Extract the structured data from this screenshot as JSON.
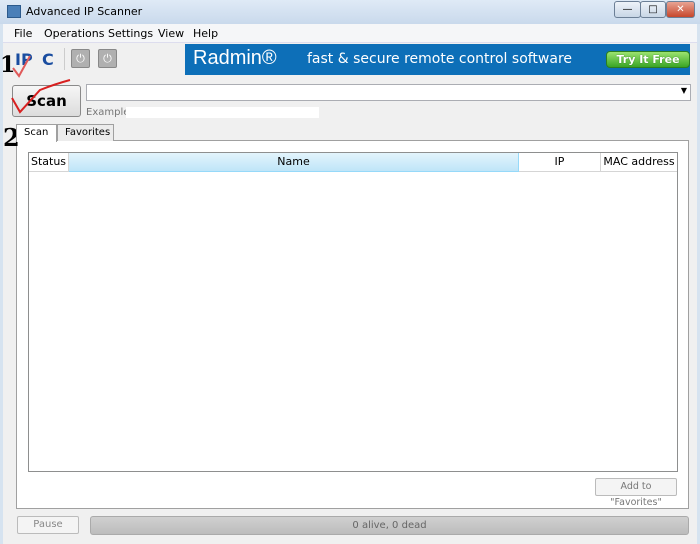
{
  "window": {
    "title": "Advanced IP Scanner",
    "controls": {
      "minimize": "—",
      "maximize": "□",
      "close": "✕"
    }
  },
  "menu": [
    "File",
    "Operations",
    "Settings",
    "View",
    "Help"
  ],
  "toolbar": {
    "ip_label": "IP",
    "c_label": "C",
    "power1": "⏻",
    "power2": "⏻"
  },
  "banner": {
    "logo": "Radmin®",
    "slogan": "fast & secure remote control software",
    "cta": "Try It Free",
    "color": "#0d6fb8"
  },
  "scan": {
    "button": "Scan",
    "ip_range_value": "",
    "example_label": "Example:",
    "example_value": ""
  },
  "tabs": [
    {
      "label": "Scan",
      "active": true
    },
    {
      "label": "Favorites",
      "active": false
    }
  ],
  "table": {
    "columns": [
      "Status",
      "Name",
      "IP",
      "MAC address"
    ],
    "sorted_column": "Name",
    "rows": []
  },
  "buttons": {
    "add_favorites": "Add to \"Favorites\"",
    "pause": "Pause"
  },
  "status": {
    "text": "0 alive, 0 dead",
    "progress": 0
  },
  "annotations": {
    "step1": "1",
    "step2": "2",
    "check_color": "#d82020"
  }
}
